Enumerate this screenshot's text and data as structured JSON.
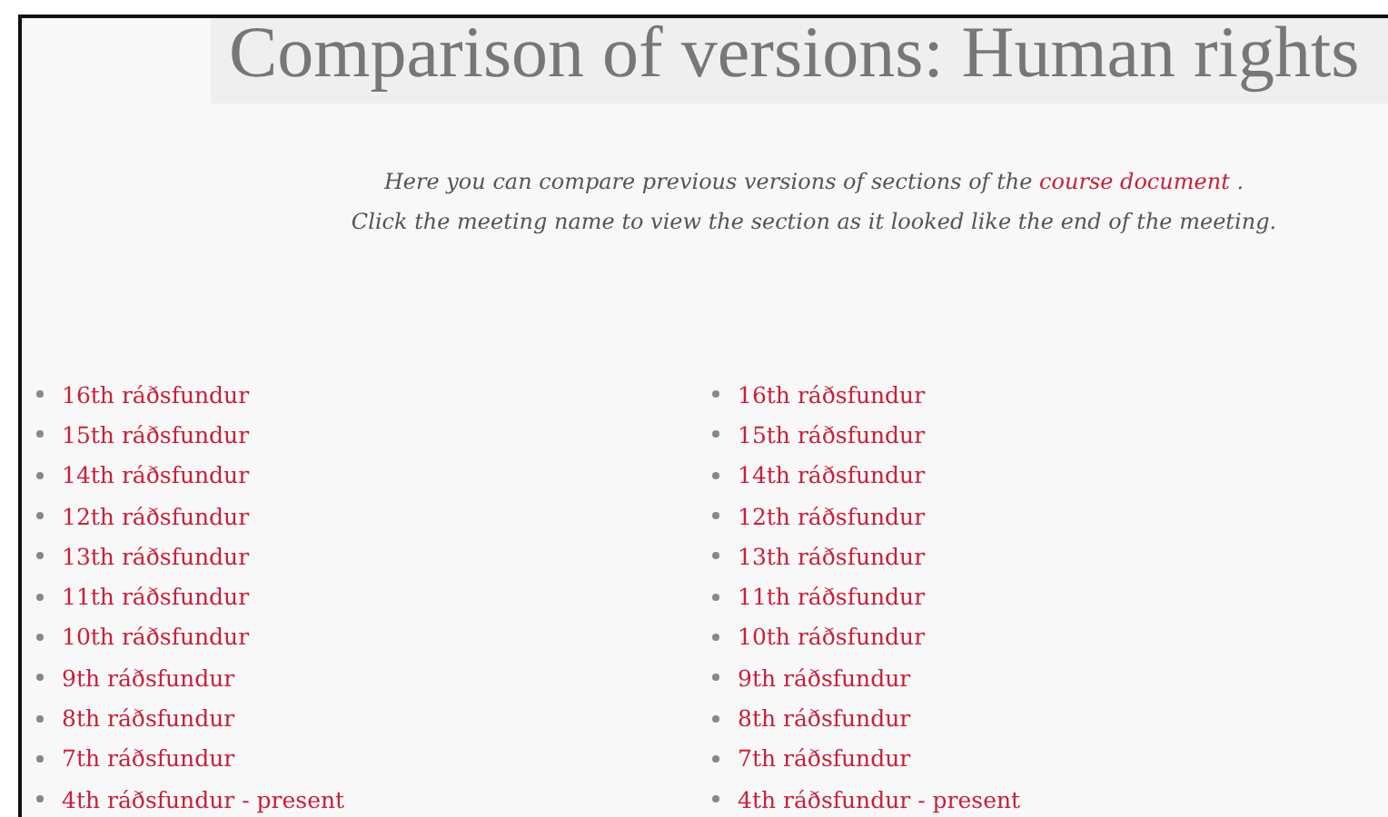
{
  "title": "Comparison of versions: Human rights",
  "intro": {
    "line_1_before": "Here you can compare previous versions of sections of the",
    "link": "course document",
    "line_1_after": ".",
    "line_2": "Click the meeting name to view the section as it looked like the end of the meeting."
  },
  "lists": [
    {
      "items": [
        "16th ráðsfundur",
        "15th ráðsfundur",
        "14th ráðsfundur",
        "12th ráðsfundur",
        "13th ráðsfundur",
        "11th ráðsfundur",
        "10th ráðsfundur",
        "9th ráðsfundur",
        "8th ráðsfundur",
        "7th ráðsfundur",
        "4th ráðsfundur - present"
      ]
    },
    {
      "items": [
        "16th ráðsfundur",
        "15th ráðsfundur",
        "14th ráðsfundur",
        "12th ráðsfundur",
        "13th ráðsfundur",
        "11th ráðsfundur",
        "10th ráðsfundur",
        "9th ráðsfundur",
        "8th ráðsfundur",
        "7th ráðsfundur",
        "4th ráðsfundur - present"
      ]
    }
  ]
}
